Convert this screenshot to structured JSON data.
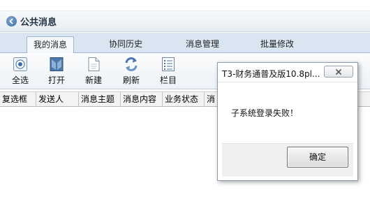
{
  "window": {
    "title": "公共消息"
  },
  "tabs": [
    {
      "label": "我的消息",
      "active": true
    },
    {
      "label": "协同历史",
      "active": false
    },
    {
      "label": "消息管理",
      "active": false
    },
    {
      "label": "批量修改",
      "active": false
    }
  ],
  "toolbar": {
    "buttons": [
      {
        "label": "全选",
        "icon": "select-all-icon"
      },
      {
        "label": "打开",
        "icon": "open-icon"
      },
      {
        "label": "新建",
        "icon": "new-document-icon"
      },
      {
        "label": "刷新",
        "icon": "refresh-icon"
      },
      {
        "label": "栏目",
        "icon": "columns-list-icon"
      }
    ]
  },
  "grid": {
    "columns": [
      "复选框",
      "发送人",
      "消息主题",
      "消息内容",
      "业务状态",
      "消"
    ]
  },
  "dialog": {
    "title": "T3-财务通普及版10.8pl...",
    "message": "子系统登录失败！",
    "ok_label": "确定"
  },
  "colors": {
    "tab_bar": "#d9e5f1",
    "accent": "#3d6fa8",
    "dialog_footer": "#f0f0f0"
  }
}
